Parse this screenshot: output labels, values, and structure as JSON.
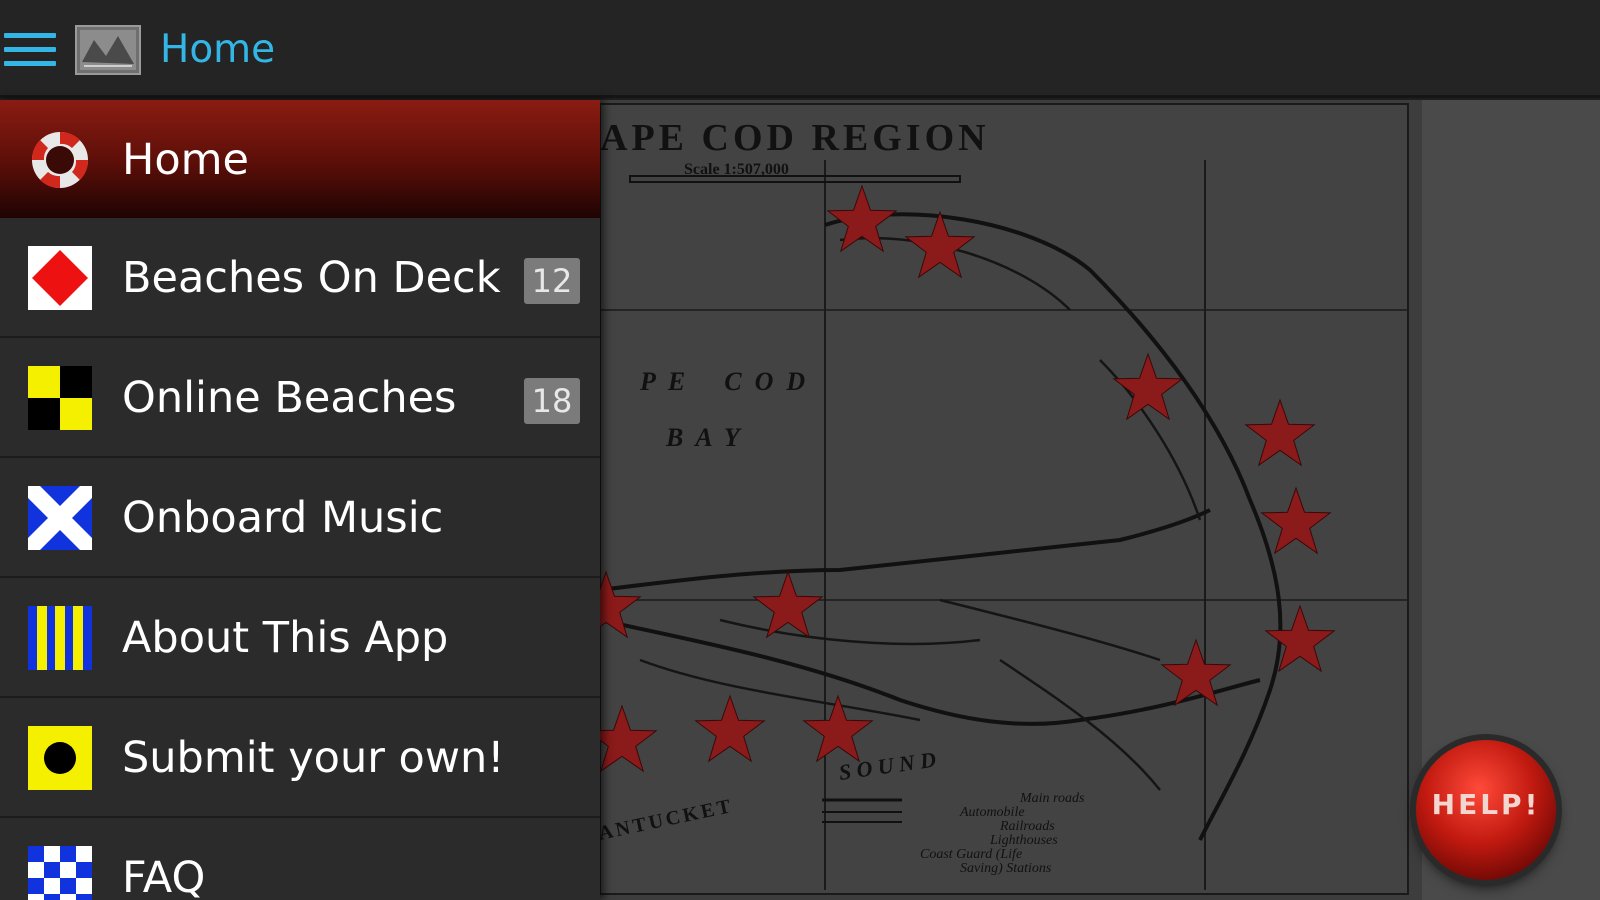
{
  "actionbar": {
    "title": "Home"
  },
  "map": {
    "title": "APE COD REGION",
    "scale": "Scale 1:507,000",
    "bay_word_1": "P  E      C  O  D",
    "bay_word_2": "B  A  Y",
    "sound": "S O U N D",
    "nantucket": "ANTUCKET",
    "legend": [
      "Main roads",
      "Automobile",
      "Railroads",
      "Lighthouses",
      "Coast Guard (Life",
      "Saving) Stations"
    ],
    "colors": {
      "star": "#8b1a1a",
      "paper": "#3d3d3d",
      "ink": "#111111"
    }
  },
  "drawer": {
    "items": [
      {
        "label": "Home",
        "icon": "lifebuoy-icon",
        "count": ""
      },
      {
        "label": "Beaches On Deck",
        "icon": "red-diamond-flag-icon",
        "count": "12"
      },
      {
        "label": "Online Beaches",
        "icon": "yellow-black-checker-flag-icon",
        "count": "18"
      },
      {
        "label": "Onboard Music",
        "icon": "blue-white-cross-flag-icon",
        "count": ""
      },
      {
        "label": "About This App",
        "icon": "blue-yellow-stripes-flag-icon",
        "count": ""
      },
      {
        "label": "Submit your own!",
        "icon": "yellow-black-dot-flag-icon",
        "count": ""
      },
      {
        "label": "FAQ",
        "icon": "blue-white-checker-flag-icon",
        "count": ""
      }
    ]
  },
  "help": {
    "label": "HELP!"
  },
  "colors": {
    "accent": "#33b5e5",
    "active_item": "#8a1c12",
    "badge": "#7b7b7b"
  }
}
